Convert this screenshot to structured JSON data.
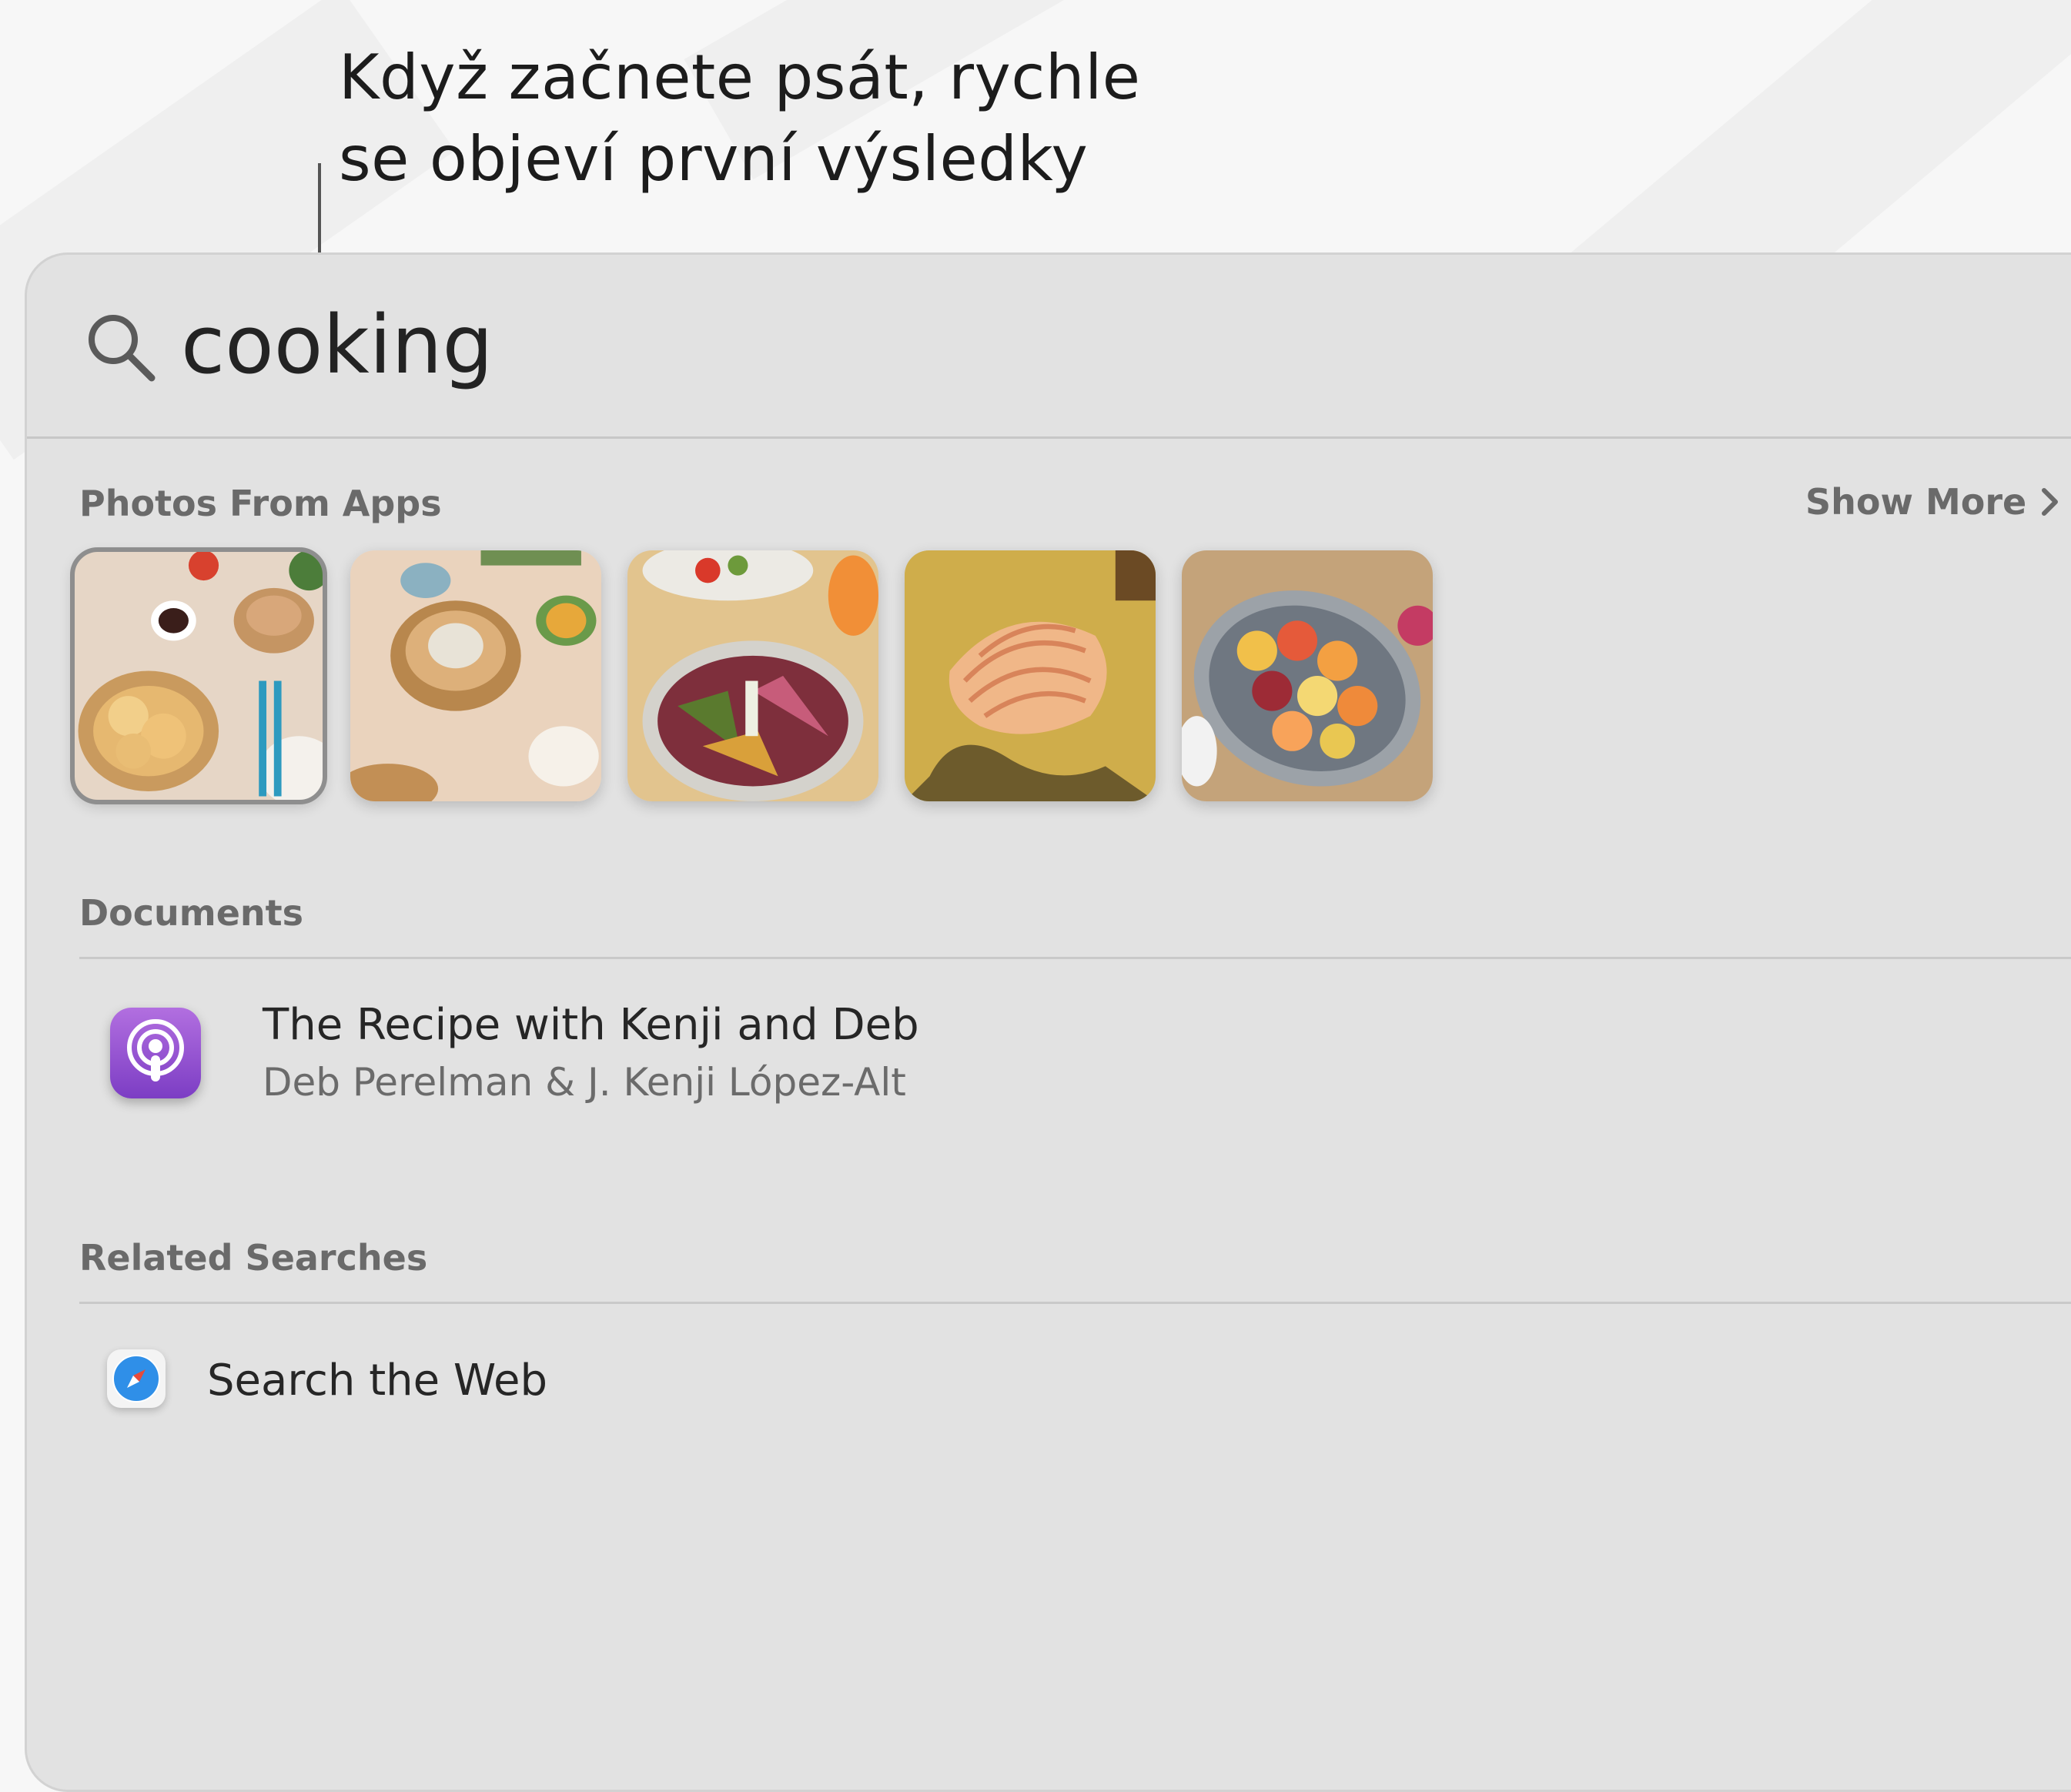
{
  "callout": {
    "line1": "Když začnete psát, rychle",
    "line2": "se objeví první výsledky"
  },
  "search": {
    "query": "cooking",
    "icon": "search-icon"
  },
  "photos_section": {
    "header": "Photos From Apps",
    "show_more": "Show More",
    "thumbnails": [
      {
        "name": "dumplings-photo",
        "selected": true
      },
      {
        "name": "steamer-basket-photo",
        "selected": false
      },
      {
        "name": "grilled-vegetables-photo",
        "selected": false
      },
      {
        "name": "scallop-shell-photo",
        "selected": false
      },
      {
        "name": "citrus-salad-photo",
        "selected": false
      }
    ]
  },
  "documents_section": {
    "header": "Documents",
    "items": [
      {
        "title": "The Recipe with Kenji and Deb",
        "subtitle": "Deb Perelman & J. Kenji López-Alt",
        "icon": "podcasts-icon"
      }
    ]
  },
  "related_section": {
    "header": "Related Searches",
    "items": [
      {
        "label": "Search the Web",
        "icon": "safari-icon"
      }
    ]
  },
  "colors": {
    "panel_bg": "#e2e2e2",
    "podcast_purple": "#8e4fd0",
    "safari_blue": "#2f8fe8"
  }
}
